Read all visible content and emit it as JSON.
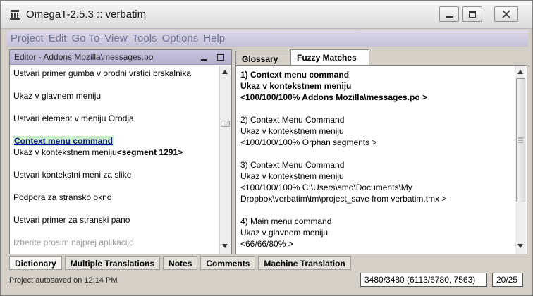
{
  "window": {
    "title": "OmegaT-2.5.3 :: verbatim"
  },
  "menu": [
    "Project",
    "Edit",
    "Go To",
    "View",
    "Tools",
    "Options",
    "Help"
  ],
  "editor": {
    "title": "Editor - Addons Mozilla\\messages.po",
    "segments": [
      {
        "text": "Ustvari primer gumba v orodni vrstici brskalnika"
      },
      {
        "text": "Ukaz v glavnem meniju"
      },
      {
        "text": "Ustvari element v meniju Orodja"
      },
      {
        "text": "Context menu command"
      },
      {
        "text": "Ukaz v kontekstnem meniju",
        "tag": "<segment 1291>"
      },
      {
        "text": "Ustvari kontekstni meni za slike"
      },
      {
        "text": "Podpora za stransko okno"
      },
      {
        "text": "Ustvari primer za stranski pano"
      },
      {
        "text": "Izberite prosim najprej aplikacijo"
      }
    ]
  },
  "tabs": {
    "glossary": "Glossary",
    "fuzzy": "Fuzzy Matches"
  },
  "fuzzy_matches": [
    "1) Context menu command",
    "Ukaz v kontekstnem meniju",
    "<100/100/100% Addons Mozilla\\messages.po >",
    "2) Context Menu Command",
    "Ukaz v kontekstnem meniju",
    "<100/100/100% Orphan segments >",
    "3) Context Menu Command",
    "Ukaz v kontekstnem meniju",
    "<100/100/100% C:\\Users\\smo\\Documents\\My",
    "Dropbox\\verbatim\\tm\\project_save from verbatim.tmx >",
    "4) Main menu command",
    "Ukaz v glavnem meniju",
    "<66/66/80%  >"
  ],
  "bottom_tabs": [
    "Dictionary",
    "Multiple Translations",
    "Notes",
    "Comments",
    "Machine Translation"
  ],
  "status": {
    "message": "Project autosaved on 12:14 PM",
    "progress": "3480/3480 (6113/6780, 7563)",
    "count": "20/25"
  }
}
